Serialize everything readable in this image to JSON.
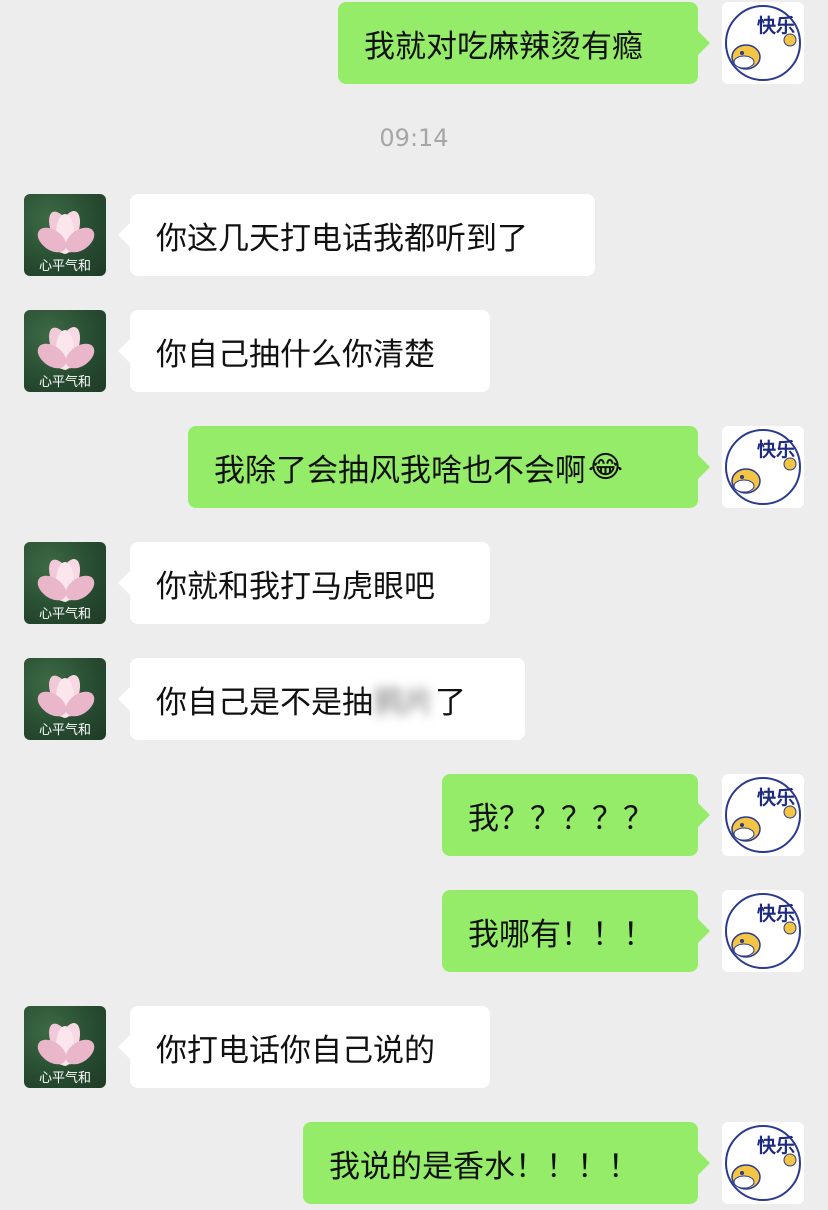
{
  "avatars": {
    "other_caption": "心平气和",
    "self_text": "快乐"
  },
  "timestamp": "09:14",
  "messages": [
    {
      "side": "right",
      "text": "我就对吃麻辣烫有瘾"
    },
    {
      "side": "left",
      "text": "你这几天打电话我都听到了"
    },
    {
      "side": "left",
      "text": "你自己抽什么你清楚"
    },
    {
      "side": "right",
      "text": "我除了会抽风我啥也不会啊",
      "emoji": "😂"
    },
    {
      "side": "left",
      "text": "你就和我打马虎眼吧"
    },
    {
      "side": "left",
      "text_prefix": "你自己是不是抽",
      "text_blurred": "鸦片",
      "text_suffix": "了"
    },
    {
      "side": "right",
      "text": "我？？？？？"
    },
    {
      "side": "right",
      "text": "我哪有！！！"
    },
    {
      "side": "left",
      "text": "你打电话你自己说的"
    },
    {
      "side": "right",
      "text": "我说的是香水！！！！"
    }
  ],
  "colors": {
    "background": "#ededed",
    "self_bubble": "#95ec69",
    "other_bubble": "#ffffff"
  }
}
